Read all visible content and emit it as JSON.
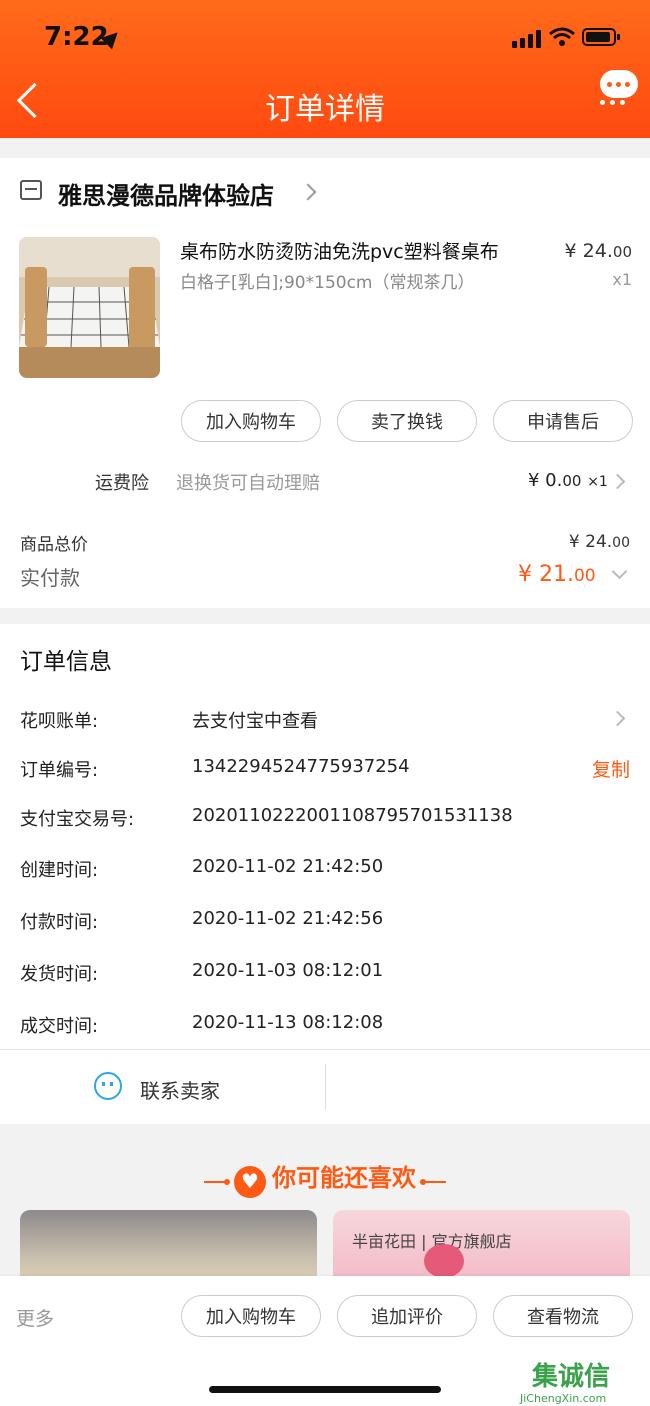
{
  "status": {
    "time": "7:22"
  },
  "header": {
    "title": "订单详情"
  },
  "store": {
    "name": "雅思漫德品牌体验店"
  },
  "product": {
    "title": "桌布防水防烫防油免洗pvc塑料餐桌布",
    "spec": "白格子[乳白];90*150cm（常规茶几）",
    "price_int": "¥ 24.",
    "price_dec": "00",
    "qty": "x1"
  },
  "item_actions": {
    "add_cart": "加入购物车",
    "sell": "卖了换钱",
    "after_sale": "申请售后"
  },
  "shipping_insurance": {
    "label": "运费险",
    "desc": "退换货可自动理赔",
    "price_int": "¥ 0.",
    "price_dec": "00",
    "qty": "×1"
  },
  "totals": {
    "goods_label": "商品总价",
    "goods_int": "¥ 24.",
    "goods_dec": "00",
    "paid_label": "实付款",
    "paid_int": "¥ 21.",
    "paid_dec": "00"
  },
  "order_info": {
    "title": "订单信息",
    "huabei_label": "花呗账单:",
    "huabei_value": "去支付宝中查看",
    "order_no_label": "订单编号:",
    "order_no_value": "1342294524775937254",
    "copy": "复制",
    "alipay_label": "支付宝交易号:",
    "alipay_value": "2020110222001108795701531138",
    "created_label": "创建时间:",
    "created_value": "2020-11-02 21:42:50",
    "paid_time_label": "付款时间:",
    "paid_time_value": "2020-11-02 21:42:56",
    "ship_label": "发货时间:",
    "ship_value": "2020-11-03 08:12:01",
    "done_label": "成交时间:",
    "done_value": "2020-11-13 08:12:08"
  },
  "contact": {
    "label": "联系卖家"
  },
  "recommend": {
    "title": "你可能还喜欢",
    "brand": "半亩花田 | 官方旗舰店"
  },
  "bottom": {
    "more": "更多",
    "add_cart": "加入购物车",
    "review": "追加评价",
    "logistics": "查看物流"
  },
  "watermark": {
    "text": "集诚信",
    "sub": "JiChengXin.com"
  },
  "colors": {
    "accent": "#ff5a14",
    "header": "#ff5a14"
  }
}
